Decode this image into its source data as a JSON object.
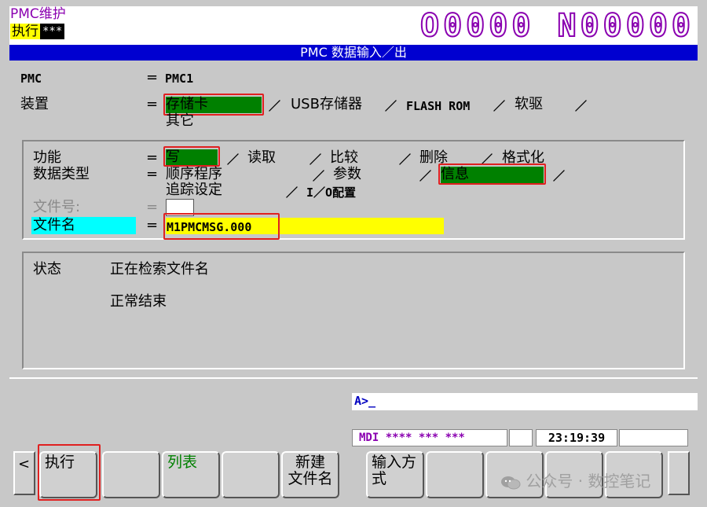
{
  "header": {
    "mode_title": "PMC维护",
    "exec_label": "执行",
    "exec_stars": "***",
    "program_number": "O0000 N00000"
  },
  "title_bar": "PMC 数据输入／出",
  "form": {
    "pmc_label": "PMC",
    "pmc_eq": "=",
    "pmc_value": "PMC1",
    "device_label": "装置",
    "device_eq": "=",
    "device_options": [
      "存储卡",
      "USB存储器",
      "FLASH ROM",
      "软驱",
      "其它"
    ],
    "device_sep": "／",
    "function_label": "功能",
    "function_eq": "=",
    "function_options": [
      "写",
      "读取",
      "比较",
      "删除",
      "格式化"
    ],
    "datatype_label": "数据类型",
    "datatype_eq": "=",
    "datatype_options": [
      "顺序程序",
      "参数",
      "信息",
      "追踪设定",
      "I／O配置"
    ],
    "fileno_label": "文件号:",
    "fileno_eq": "=",
    "filename_label": "文件名",
    "filename_eq": "=",
    "filename_value": "M1PMCMSG.000"
  },
  "status": {
    "label": "状态",
    "line1": "正在检索文件名",
    "line2": "正常结束"
  },
  "command_line": "A>_",
  "status_bar": {
    "mode": "MDI  **** ***  ***",
    "time": "23:19:39"
  },
  "softkeys": {
    "left_arrow": "<",
    "keys": [
      "执行",
      "",
      "列表",
      "",
      "新建\n文件名",
      "输入方\n式",
      "",
      "",
      "",
      ""
    ],
    "right_arrow": ""
  },
  "watermark": "公众号 · 数控笔记",
  "colors": {
    "selected_option": "#008000",
    "title_bar": "#0000d0",
    "highlight_yellow": "#ffff00",
    "highlight_cyan": "#00ffff",
    "annotation_red": "#e02020",
    "program_number": "#8a00b0"
  }
}
